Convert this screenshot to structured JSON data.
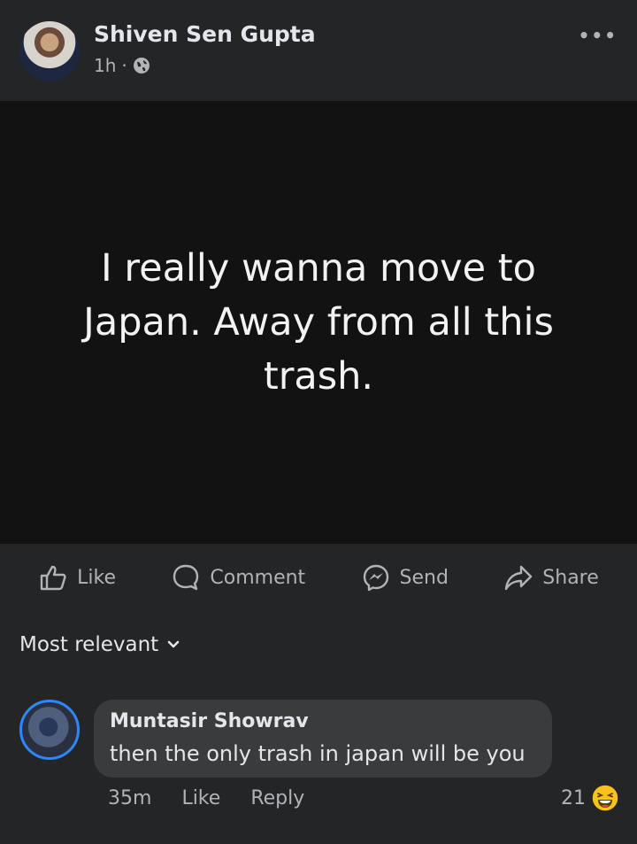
{
  "post": {
    "author": "Shiven Sen Gupta",
    "time": "1h",
    "separator": "·",
    "text": "I really wanna move to Japan. Away from all this trash."
  },
  "actions": {
    "like": "Like",
    "comment": "Comment",
    "send": "Send",
    "share": "Share"
  },
  "comments_sort": "Most relevant",
  "comment": {
    "author": "Muntasir Showrav",
    "text": "then the only trash in japan will be you",
    "time": "35m",
    "like": "Like",
    "reply": "Reply",
    "reaction_count": "21"
  },
  "icons": {
    "privacy": "globe-icon",
    "menu": "more-options-icon",
    "reaction": "laughing-emoji-icon"
  },
  "colors": {
    "background": "#242526",
    "post_background": "#121212",
    "bubble": "#3a3b3c",
    "accent": "#2d88ff"
  }
}
